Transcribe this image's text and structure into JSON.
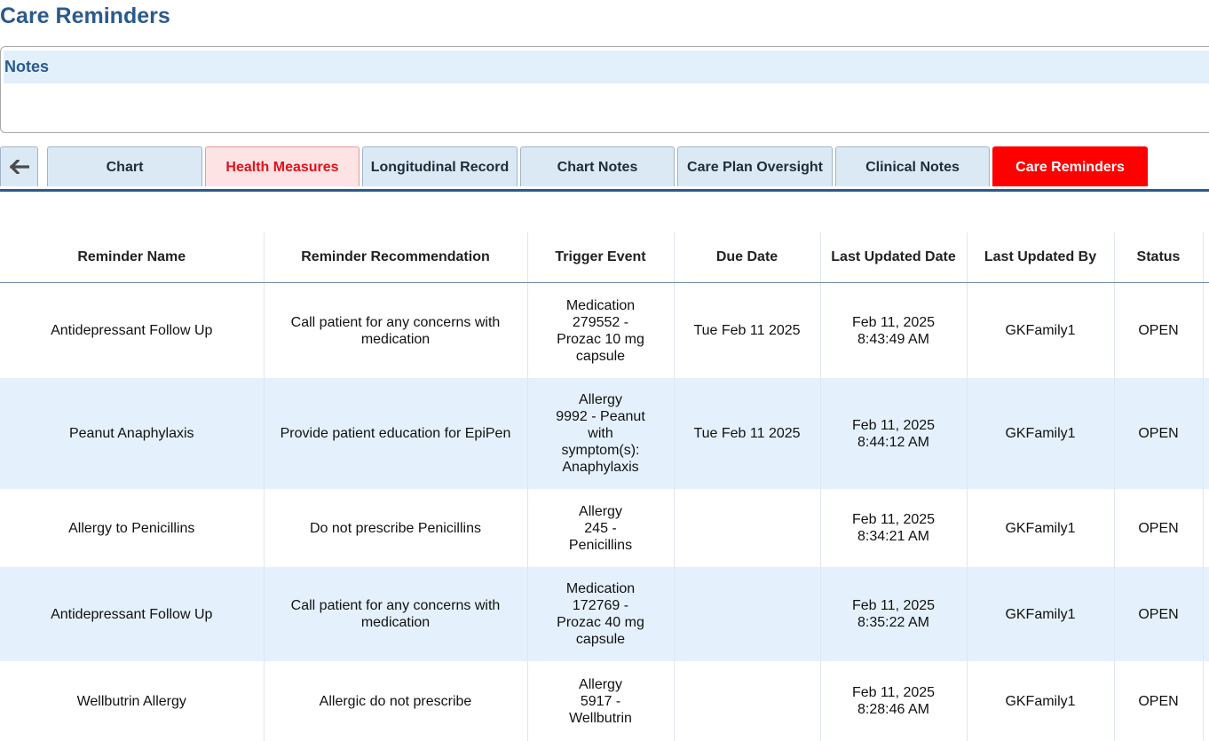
{
  "page": {
    "title": "Care Reminders"
  },
  "notes": {
    "label": "Notes"
  },
  "tabs": {
    "back_icon": "arrow-left-icon",
    "items": [
      {
        "label": "Chart",
        "state": "normal"
      },
      {
        "label": "Health Measures",
        "state": "alert"
      },
      {
        "label": "Longitudinal Record",
        "state": "normal"
      },
      {
        "label": "Chart Notes",
        "state": "normal"
      },
      {
        "label": "Care Plan Oversight",
        "state": "normal"
      },
      {
        "label": "Clinical Notes",
        "state": "normal"
      },
      {
        "label": "Care Reminders",
        "state": "active"
      }
    ]
  },
  "table": {
    "headers": [
      "Reminder Name",
      "Reminder Recommendation",
      "Trigger Event",
      "Due Date",
      "Last Updated Date",
      "Last Updated By",
      "Status"
    ],
    "rows": [
      {
        "name": "Antidepressant Follow Up",
        "recommendation": "Call patient for any concerns with medication",
        "trigger": [
          "Medication",
          "279552 -",
          "Prozac 10 mg",
          "capsule"
        ],
        "due": "Tue Feb 11 2025",
        "updated_date": "Feb 11, 2025",
        "updated_time": "8:43:49 AM",
        "updated_by": "GKFamily1",
        "status": "OPEN"
      },
      {
        "name": "Peanut Anaphylaxis",
        "recommendation": "Provide patient education for EpiPen",
        "trigger": [
          "Allergy",
          "9992 - Peanut",
          "with",
          "symptom(s):",
          "Anaphylaxis"
        ],
        "due": "Tue Feb 11 2025",
        "updated_date": "Feb 11, 2025",
        "updated_time": "8:44:12 AM",
        "updated_by": "GKFamily1",
        "status": "OPEN"
      },
      {
        "name": "Allergy to Penicillins",
        "recommendation": "Do not prescribe Penicillins",
        "trigger": [
          "Allergy",
          "245 -",
          "Penicillins"
        ],
        "due": "",
        "updated_date": "Feb 11, 2025",
        "updated_time": "8:34:21 AM",
        "updated_by": "GKFamily1",
        "status": "OPEN"
      },
      {
        "name": "Antidepressant Follow Up",
        "recommendation": "Call patient for any concerns with medication",
        "trigger": [
          "Medication",
          "172769 -",
          "Prozac 40 mg",
          "capsule"
        ],
        "due": "",
        "updated_date": "Feb 11, 2025",
        "updated_time": "8:35:22 AM",
        "updated_by": "GKFamily1",
        "status": "OPEN"
      },
      {
        "name": "Wellbutrin Allergy",
        "recommendation": "Allergic do not prescribe",
        "trigger": [
          "Allergy",
          "5917 -",
          "Wellbutrin"
        ],
        "due": "",
        "updated_date": "Feb 11, 2025",
        "updated_time": "8:28:46 AM",
        "updated_by": "GKFamily1",
        "status": "OPEN"
      }
    ]
  },
  "colors": {
    "title": "#2b5a8a",
    "notes_header_bg": "#e2f0fb",
    "tab_bg": "#dbe9f5",
    "tab_alert_bg": "#fde3e3",
    "tab_alert_text": "#e0121b",
    "tab_active_bg": "#ff0000",
    "row_alt_bg": "#e4f1fc"
  }
}
